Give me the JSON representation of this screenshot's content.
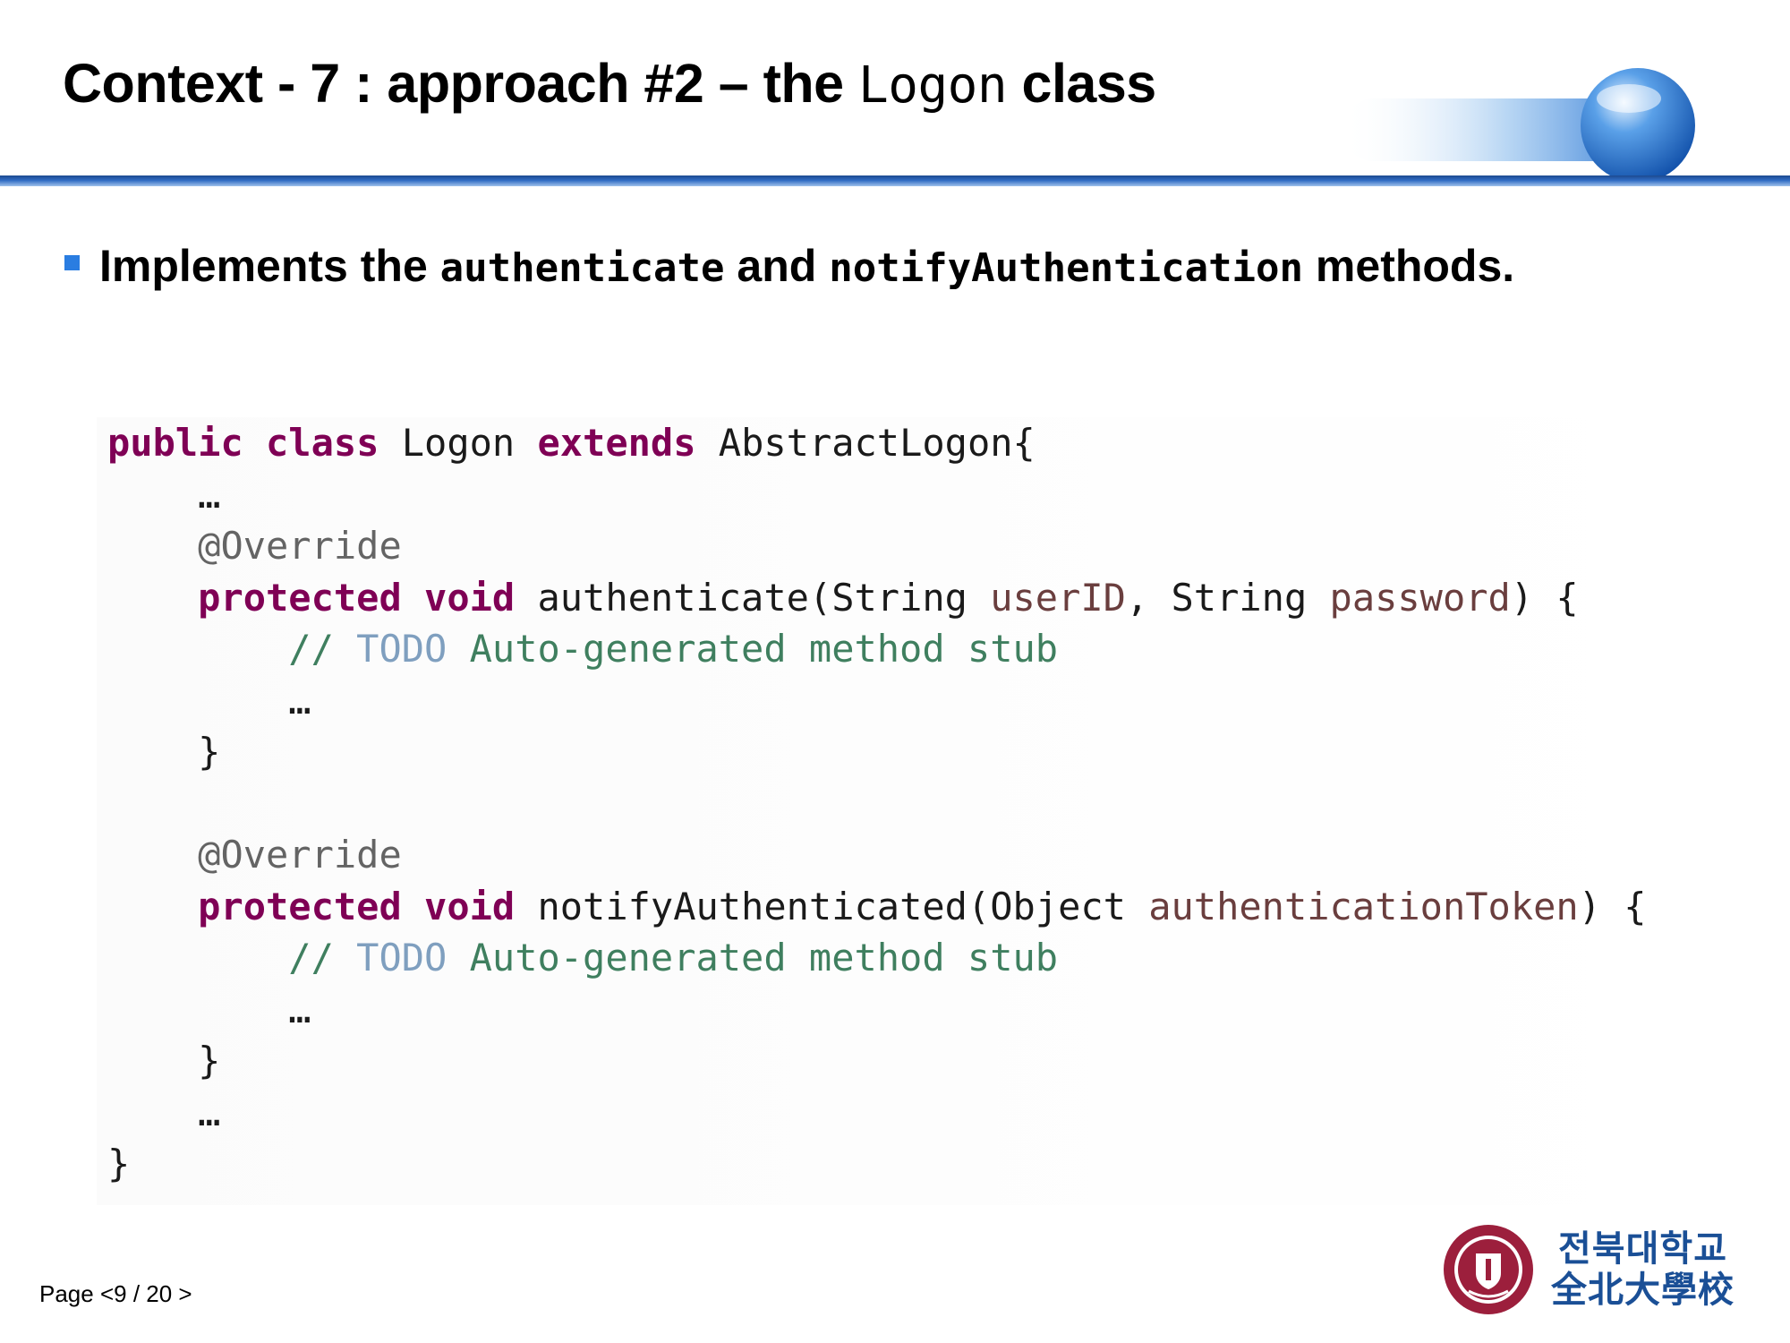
{
  "slide": {
    "title_prefix": "Context - 7 : approach #2 – the ",
    "title_code": "Logon",
    "title_suffix": " class",
    "bullet": {
      "text_1": "Implements the ",
      "code_1": "authenticate",
      "text_2": " and ",
      "code_2": "notifyAuthentication",
      "text_3": " methods."
    }
  },
  "code": {
    "line1": {
      "kw1": "public",
      "kw2": "class",
      "name": "Logon",
      "kw3": "extends",
      "base": "AbstractLogon{"
    },
    "line2": "…",
    "line3": "@Override",
    "line4": {
      "kw1": "protected",
      "kw2": "void",
      "sig1": "authenticate(String",
      "p1": "userID",
      "sig2": ", String",
      "p2": "password",
      "sig3": ") {"
    },
    "line5": {
      "slashes": "//",
      "todo": "TODO",
      "text": "Auto-generated method stub"
    },
    "line6": "…",
    "line7": "}",
    "line9": "@Override",
    "line10": {
      "kw1": "protected",
      "kw2": "void",
      "sig1": "notifyAuthenticated(Object",
      "p1": "authenticationToken",
      "sig2": ") {"
    },
    "line11": {
      "slashes": "//",
      "todo": "TODO",
      "text": "Auto-generated method stub"
    },
    "line12": "…",
    "line13": "}",
    "line14": "…",
    "line15": "}"
  },
  "footer": {
    "page": "Page <9 / 20 >",
    "logo_line1": "전북대학교",
    "logo_line2": "全北大學校"
  },
  "colors": {
    "keyword": "#7f0055",
    "annotation": "#646464",
    "parameter": "#6a3e3e",
    "comment": "#3f7f5f",
    "todo": "#7f9fbf",
    "accent": "#2a7de1",
    "logo": "#1a4f96",
    "seal": "#9c1f3c"
  }
}
